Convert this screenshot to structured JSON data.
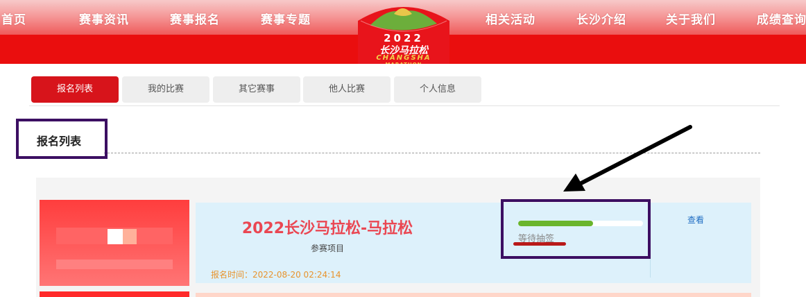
{
  "nav": {
    "items": [
      "首页",
      "赛事资讯",
      "赛事报名",
      "赛事专题",
      "相关活动",
      "长沙介绍",
      "关于我们",
      "成绩查询"
    ]
  },
  "logo": {
    "year": "2022",
    "name_cn": "长沙马拉松",
    "name_en_1": "CHANGSHA",
    "name_en_2": "MARATHON"
  },
  "tabs": [
    {
      "label": "报名列表",
      "active": true
    },
    {
      "label": "我的比赛",
      "active": false
    },
    {
      "label": "其它赛事",
      "active": false
    },
    {
      "label": "他人比赛",
      "active": false
    },
    {
      "label": "个人信息",
      "active": false
    }
  ],
  "section": {
    "title": "报名列表"
  },
  "registration": {
    "event_title": "2022长沙马拉松-马拉松",
    "event_subtitle": "参赛项目",
    "time_label": "报名时间：2022-08-20 02:24:14",
    "progress": 0.6,
    "status": "等待抽签",
    "view_label": "查看"
  },
  "colors": {
    "nav_red": "#ea0e0e",
    "tab_active": "#d7141b",
    "title_red": "#ea4752",
    "progress_green": "#6ab52c",
    "link_blue": "#1f6dc3",
    "annotation_purple": "#3c0f62"
  }
}
